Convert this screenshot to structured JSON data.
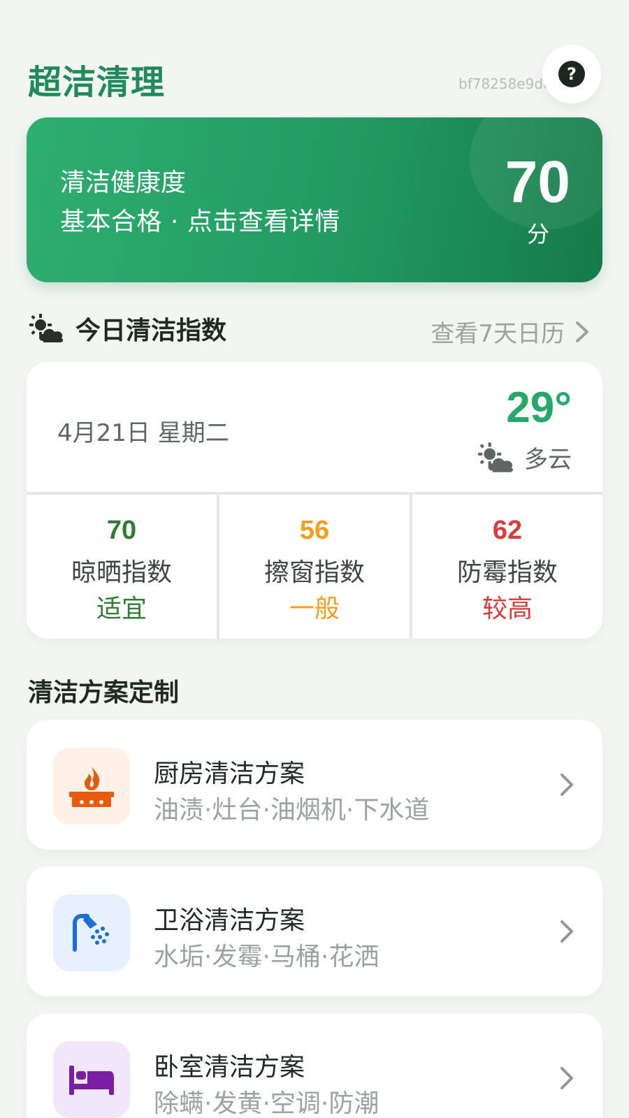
{
  "header": {
    "app_title": "超洁清理",
    "device_id": "bf78258e9dd812c",
    "help_icon": "question-circle-icon"
  },
  "score_card": {
    "title": "清洁健康度",
    "subtitle": "基本合格 · 点击查看详情",
    "score": "70",
    "unit": "分"
  },
  "today_index": {
    "title": "今日清洁指数",
    "link": "查看7天日历",
    "date": "4月21日 星期二",
    "temperature": "29°",
    "weather": "多云",
    "weather_icon": "partly-cloudy-icon",
    "indices": [
      {
        "value": "70",
        "label": "晾晒指数",
        "level": "适宜",
        "color": "#2e7d32"
      },
      {
        "value": "56",
        "label": "擦窗指数",
        "level": "一般",
        "color": "#f0a020"
      },
      {
        "value": "62",
        "label": "防霉指数",
        "level": "较高",
        "color": "#d93a3a"
      }
    ]
  },
  "plans": {
    "title": "清洁方案定制",
    "items": [
      {
        "name": "厨房清洁方案",
        "tags": "油渍·灶台·油烟机·下水道",
        "icon": "stove-fire-icon",
        "icon_bg": "#fff1e6",
        "icon_color": "#e8590c"
      },
      {
        "name": "卫浴清洁方案",
        "tags": "水垢·发霉·马桶·花洒",
        "icon": "shower-icon",
        "icon_bg": "#e6f1fd",
        "icon_color": "#1d6fd8"
      },
      {
        "name": "卧室清洁方案",
        "tags": "除螨·发黄·空调·防潮",
        "icon": "bed-icon",
        "icon_bg": "#f1e6fa",
        "icon_color": "#7b1fa2"
      }
    ]
  }
}
